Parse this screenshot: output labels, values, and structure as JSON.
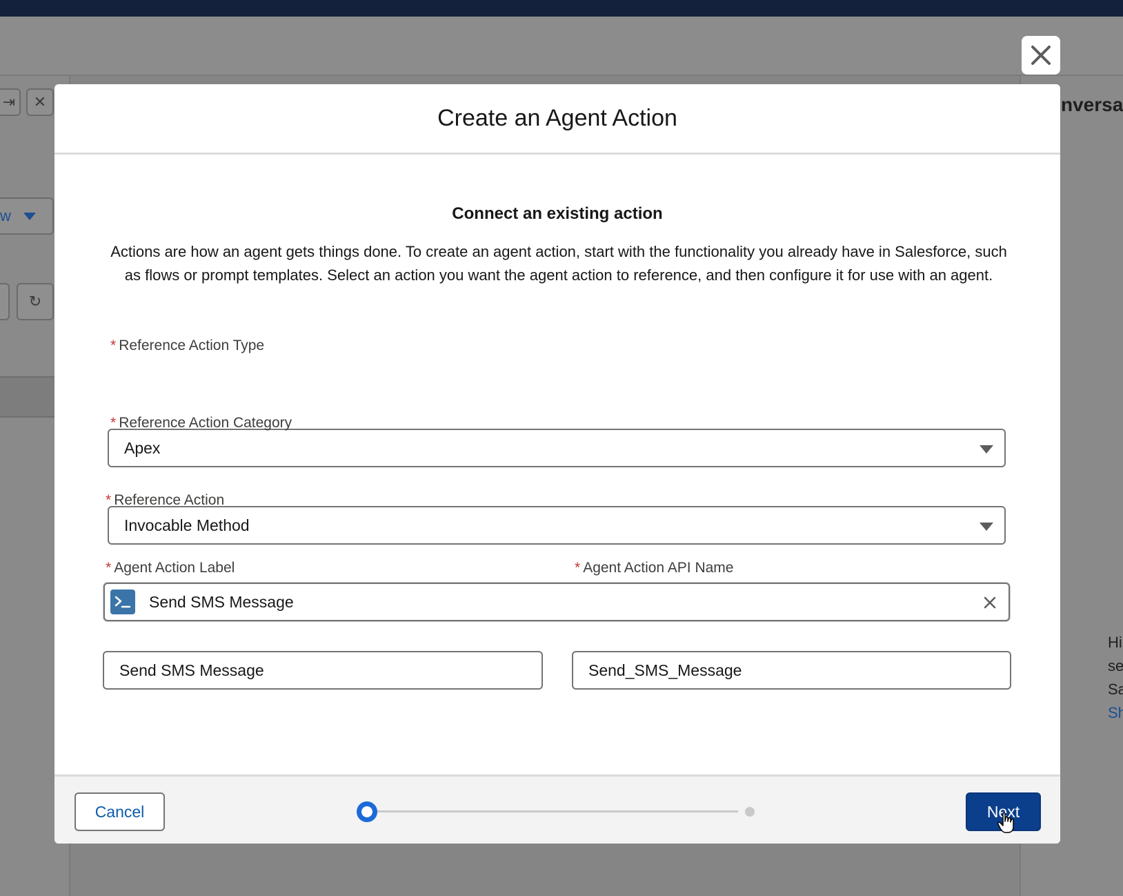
{
  "background": {
    "right_heading": "nversa",
    "left_dropdown_text": "w",
    "right_text_lines": [
      "Hi",
      "se",
      "Sa"
    ],
    "right_link": "Sh"
  },
  "modal": {
    "title": "Create an Agent Action",
    "section_title": "Connect an existing action",
    "description": "Actions are how an agent gets things done. To create an agent action, start with the functionality you already have in Salesforce, such as flows or prompt templates. Select an action you want the agent action to reference, and then configure it for use with an agent.",
    "required_marker": "*",
    "fields": {
      "reference_action_type": {
        "label": "Reference Action Type",
        "value": "Apex"
      },
      "reference_action_category": {
        "label": "Reference Action Category",
        "value": "Invocable Method"
      },
      "reference_action": {
        "label": "Reference Action",
        "value": "Send SMS Message",
        "icon": "apex-terminal-icon"
      },
      "agent_action_label": {
        "label": "Agent Action Label",
        "value": "Send SMS Message"
      },
      "agent_action_api_name": {
        "label": "Agent Action API Name",
        "value": "Send_SMS_Message"
      }
    },
    "footer": {
      "cancel_label": "Cancel",
      "next_label": "Next",
      "progress": {
        "current_step": 1,
        "total_steps": 2
      }
    }
  },
  "colors": {
    "brand_button": "#0b3f8c",
    "link_blue": "#0b5cab",
    "progress_active": "#1b6ad8",
    "required": "#c23934",
    "apex_icon_bg": "#3a74a8"
  }
}
